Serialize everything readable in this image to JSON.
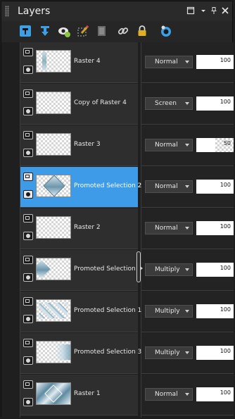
{
  "panel": {
    "title": "Layers",
    "title_buttons": [
      "restore-icon",
      "dropdown-icon",
      "pin-icon",
      "close-icon"
    ]
  },
  "toolbar": {
    "tools": [
      {
        "name": "new-raster-layer-icon",
        "color": "#3ba0e6"
      },
      {
        "name": "merge-down-icon",
        "color": "#3ba0e6"
      },
      {
        "name": "visibility-icon",
        "color": "#8cc63f"
      },
      {
        "name": "edit-selection-icon",
        "color": "#c9a227"
      },
      {
        "name": "delete-layer-icon",
        "color": "#6a6a6a"
      },
      {
        "name": "link-icon",
        "color": "#9a9a9a"
      },
      {
        "name": "lock-icon",
        "color": "#e0b020"
      },
      {
        "name": "properties-icon",
        "color": "#3ba0e6"
      }
    ]
  },
  "layers": [
    {
      "name": "Raster 4",
      "blend": "Normal",
      "opacity": "100",
      "opacity_fraction": 1.0,
      "selected": false,
      "thumb": "streak"
    },
    {
      "name": "Copy of Raster 4",
      "blend": "Screen",
      "opacity": "100",
      "opacity_fraction": 1.0,
      "selected": false,
      "thumb": "empty"
    },
    {
      "name": "Raster 3",
      "blend": "Normal",
      "opacity": "50",
      "opacity_fraction": 0.5,
      "selected": false,
      "thumb": "empty"
    },
    {
      "name": "Promoted Selection 2",
      "blend": "Normal",
      "opacity": "100",
      "opacity_fraction": 1.0,
      "selected": true,
      "thumb": "diamond"
    },
    {
      "name": "Raster 2",
      "blend": "Normal",
      "opacity": "100",
      "opacity_fraction": 1.0,
      "selected": false,
      "thumb": "empty"
    },
    {
      "name": "Promoted Selection",
      "blend": "Multiply",
      "opacity": "100",
      "opacity_fraction": 1.0,
      "selected": false,
      "thumb": "leftdiamond"
    },
    {
      "name": "Promoted Selection 1",
      "blend": "Multiply",
      "opacity": "100",
      "opacity_fraction": 1.0,
      "selected": false,
      "thumb": "pattern"
    },
    {
      "name": "Promoted Selection 3",
      "blend": "Multiply",
      "opacity": "100",
      "opacity_fraction": 1.0,
      "selected": false,
      "thumb": "rightfade"
    },
    {
      "name": "Raster 1",
      "blend": "Normal",
      "opacity": "100",
      "opacity_fraction": 1.0,
      "selected": false,
      "thumb": "full"
    }
  ],
  "colors": {
    "selection": "#3d9be8",
    "row_bg": "#2e2e2e",
    "panel_bg": "#1f1f1f"
  }
}
